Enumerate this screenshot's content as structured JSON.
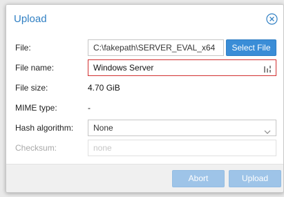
{
  "dialog": {
    "title": "Upload",
    "close_icon": "close-circle-icon"
  },
  "form": {
    "file": {
      "label": "File:",
      "value": "C:\\fakepath\\SERVER_EVAL_x64",
      "button_label": "Select File"
    },
    "file_name": {
      "label": "File name:",
      "value": "Windows Server",
      "state": "invalid",
      "icon": "password-manager-icon"
    },
    "file_size": {
      "label": "File size:",
      "value": "4.70 GiB"
    },
    "mime_type": {
      "label": "MIME type:",
      "value": "-"
    },
    "hash_algorithm": {
      "label": "Hash algorithm:",
      "value": "None",
      "icon": "chevron-down-icon"
    },
    "checksum": {
      "label": "Checksum:",
      "placeholder": "none",
      "disabled": true
    }
  },
  "footer": {
    "abort_label": "Abort",
    "upload_label": "Upload",
    "buttons_disabled": true
  },
  "colors": {
    "title": "#2f7fc3",
    "primary_button": "#3a8dd7",
    "disabled_button": "#9ec4e8",
    "invalid_border": "#d12f2f"
  }
}
